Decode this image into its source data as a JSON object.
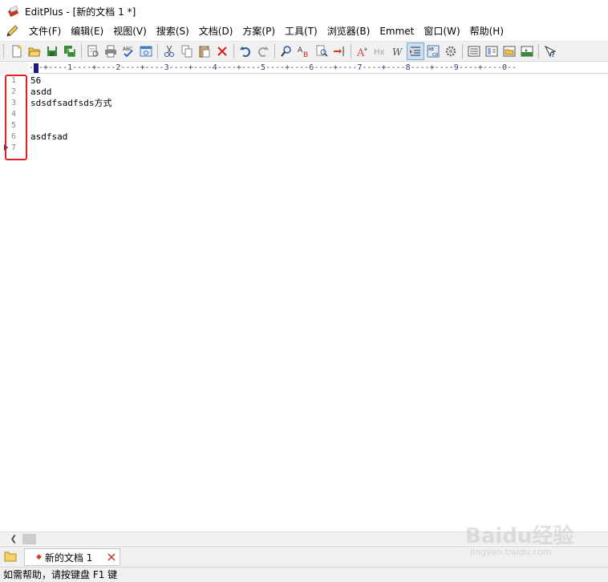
{
  "window": {
    "title": "EditPlus - [新的文档 1 *]"
  },
  "menu": {
    "items": [
      {
        "label": "文件(F)"
      },
      {
        "label": "编辑(E)"
      },
      {
        "label": "视图(V)"
      },
      {
        "label": "搜索(S)"
      },
      {
        "label": "文档(D)"
      },
      {
        "label": "方案(P)"
      },
      {
        "label": "工具(T)"
      },
      {
        "label": "浏览器(B)"
      },
      {
        "label": "Emmet"
      },
      {
        "label": "窗口(W)"
      },
      {
        "label": "帮助(H)"
      }
    ]
  },
  "toolbar": {
    "icons": [
      "new-file-icon",
      "open-folder-icon",
      "save-icon",
      "save-all-icon",
      "print-preview-icon",
      "print-icon",
      "spellcheck-icon",
      "browser-preview-icon",
      "cut-icon",
      "copy-icon",
      "paste-icon",
      "delete-icon",
      "undo-icon",
      "redo-icon",
      "find-icon",
      "replace-icon",
      "find-in-files-icon",
      "goto-line-icon",
      "font-icon",
      "hx-icon",
      "word-wrap-icon",
      "indent-icon",
      "column-select-icon",
      "settings-gear-icon",
      "html-toolbar-icon",
      "cliptext-icon",
      "directory-icon",
      "output-window-icon",
      "help-icon"
    ],
    "active_icon": "indent-icon"
  },
  "ruler": {
    "text": "---+----1----+----2----+----3----+----4----+----5----+----6----+----7----+----8----+----9----+----0--"
  },
  "editor": {
    "line_numbers": [
      "1",
      "2",
      "3",
      "4",
      "5",
      "6",
      "7"
    ],
    "lines": [
      "56",
      "asdd",
      "sdsdfsadfsds方式",
      "",
      "",
      "asdfsad",
      ""
    ],
    "current_line": 7
  },
  "tabs": [
    {
      "label": "新的文档 1"
    }
  ],
  "status": {
    "text": "如需帮助，请按键盘 F1 键"
  },
  "watermark": {
    "main": "Baidu经验",
    "sub": "jingyan.baidu.com"
  },
  "colors": {
    "highlight_box": "#e02020",
    "caret_marker": "#1a1a80",
    "toolbar_bg": "#f0f0f0"
  }
}
